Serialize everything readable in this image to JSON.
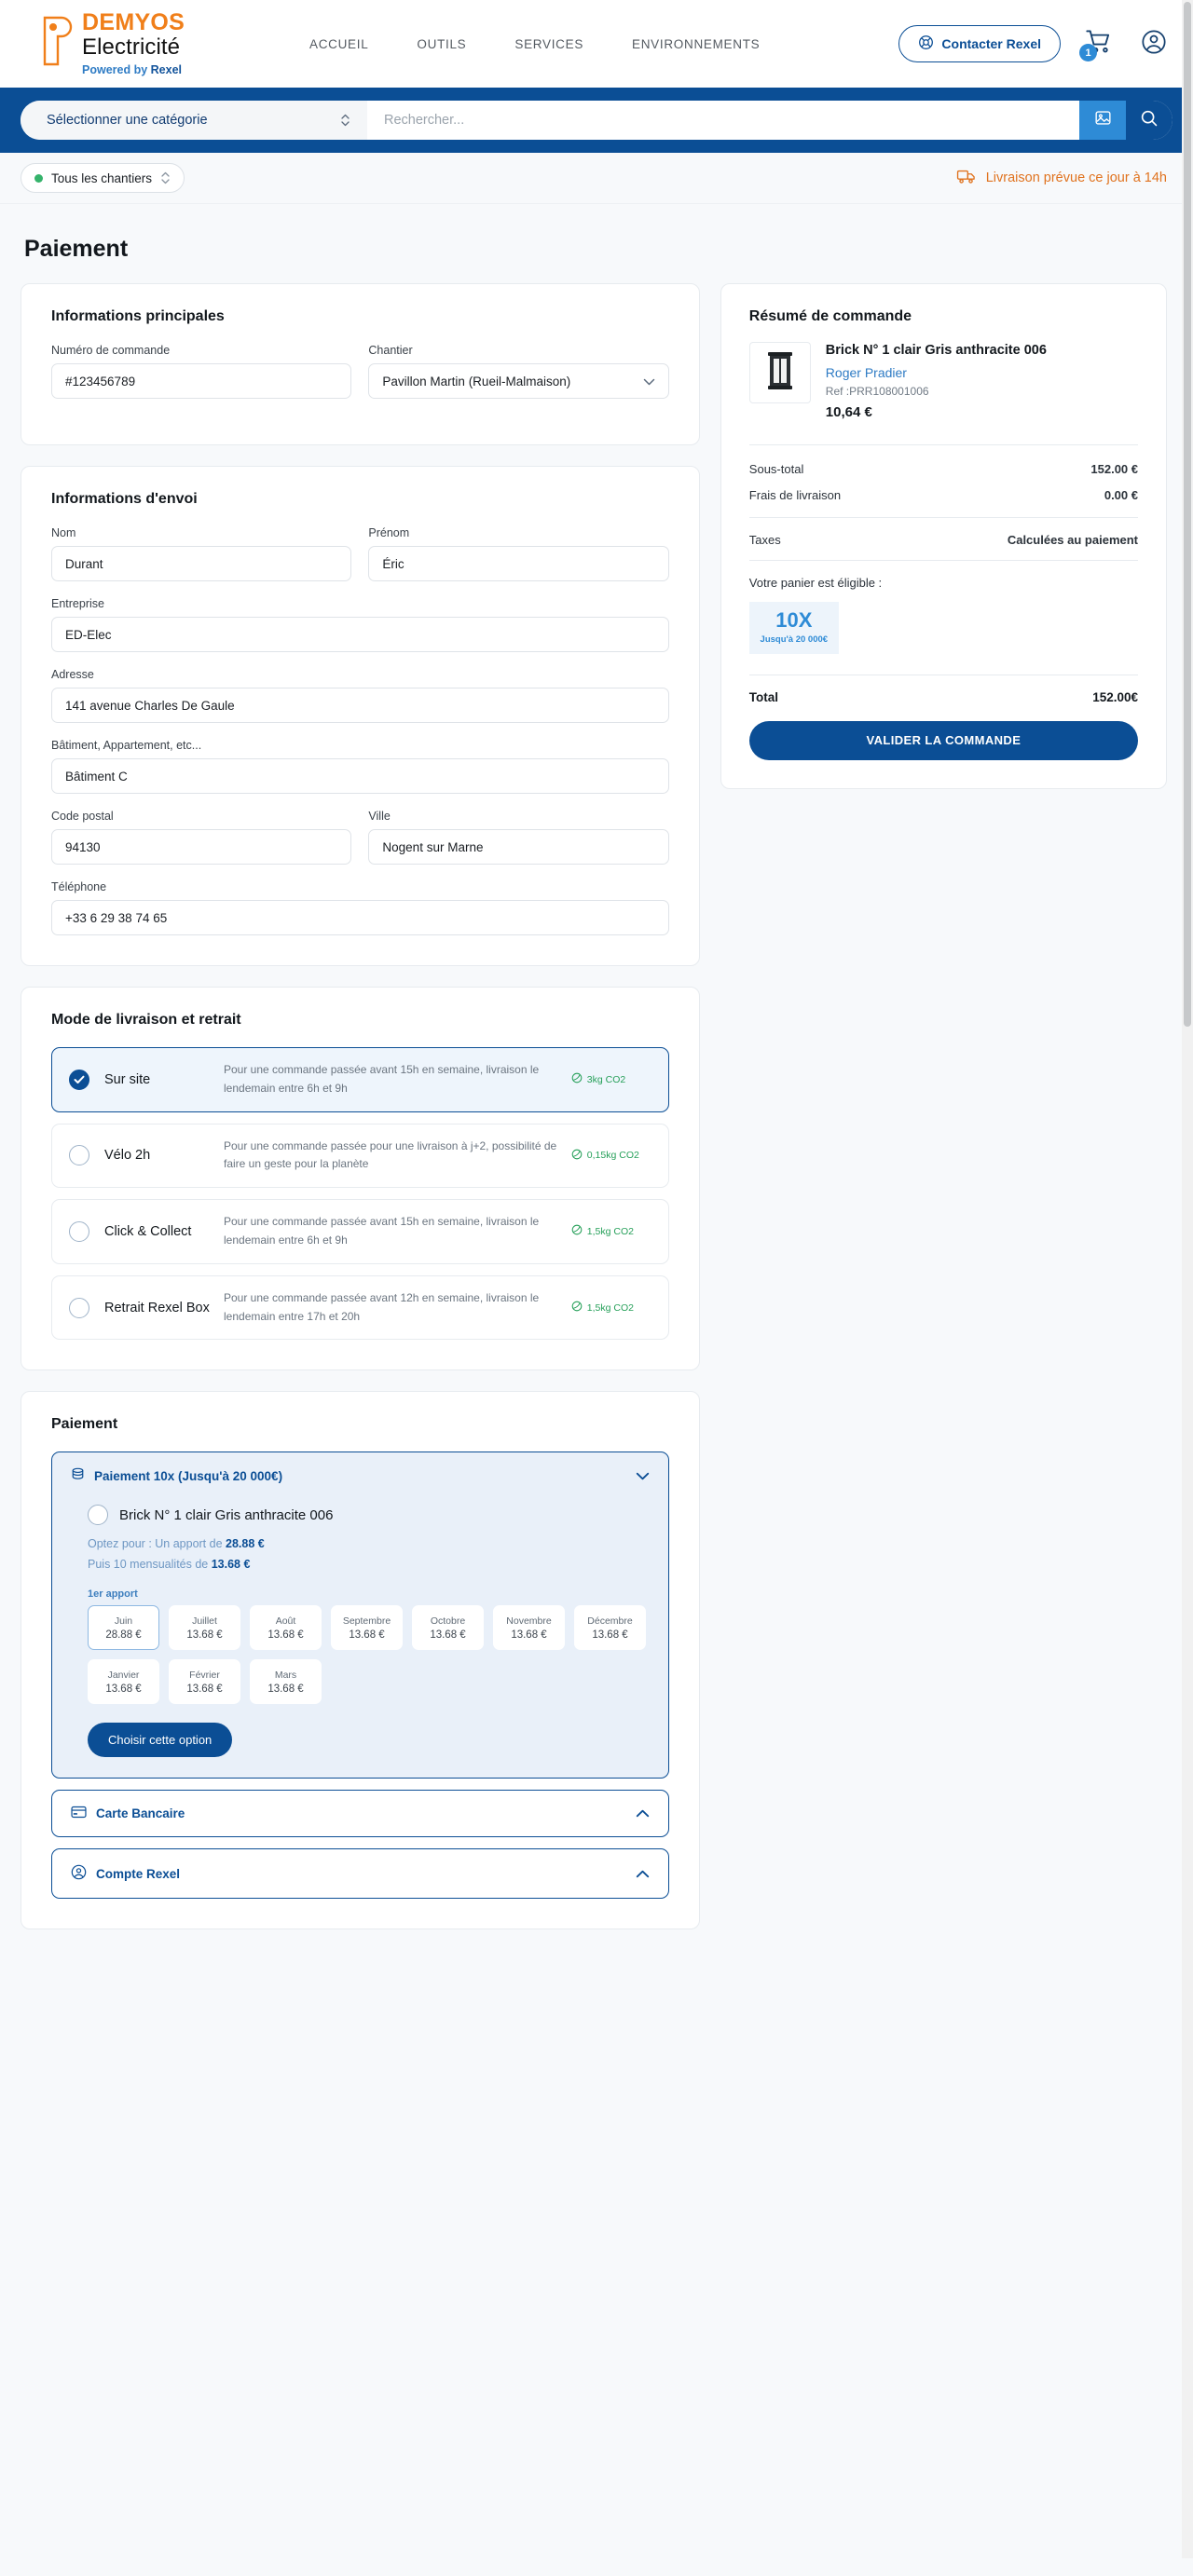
{
  "header": {
    "logo": {
      "name": "DEMYOS",
      "sub": "Electricité",
      "powered_prefix": "Powered by ",
      "powered_brand": "Rexel"
    },
    "menu": [
      "ACCUEIL",
      "OUTILS",
      "SERVICES",
      "ENVIRONNEMENTS"
    ],
    "contact_label": "Contacter Rexel",
    "cart_count": "1"
  },
  "search": {
    "category_placeholder": "Sélectionner une catégorie",
    "input_placeholder": "Rechercher...",
    "input_value": ""
  },
  "chantier_bar": {
    "selector_label": "Tous les chantiers",
    "delivery_note": "Livraison prévue ce jour à 14h"
  },
  "page": {
    "title": "Paiement"
  },
  "main_info": {
    "title": "Informations principales",
    "order_number_label": "Numéro de commande",
    "order_number_value": "#123456789",
    "chantier_label": "Chantier",
    "chantier_value": "Pavillon Martin (Rueil-Malmaison)"
  },
  "shipping": {
    "title": "Informations d'envoi",
    "fields": [
      {
        "label": "Nom",
        "value": "Durant"
      },
      {
        "label": "Prénom",
        "value": "Éric"
      },
      {
        "label": "Entreprise",
        "value": "ED-Elec"
      },
      {
        "label": "Adresse",
        "value": "141 avenue Charles De Gaule"
      },
      {
        "label": "Bâtiment, Appartement, etc...",
        "value": "Bâtiment C"
      },
      {
        "label": "Code postal",
        "value": "94130"
      },
      {
        "label": "Ville",
        "value": "Nogent sur Marne"
      },
      {
        "label": "Téléphone",
        "value": "+33 6 29 38 74 65"
      }
    ]
  },
  "delivery": {
    "title": "Mode de livraison et retrait",
    "options": [
      {
        "name": "Sur site",
        "desc": "Pour une commande passée avant 15h en semaine, livraison le lendemain entre 6h et 9h",
        "co2": "3kg CO2",
        "selected": true
      },
      {
        "name": "Vélo 2h",
        "desc": "Pour une commande passée pour une livraison à j+2, possibilité de faire un geste pour la planète",
        "co2": "0,15kg CO2",
        "selected": false
      },
      {
        "name": "Click & Collect",
        "desc": "Pour une commande passée avant 15h en semaine, livraison le lendemain entre 6h et 9h",
        "co2": "1,5kg CO2",
        "selected": false
      },
      {
        "name": "Retrait Rexel Box",
        "desc": "Pour une commande passée avant 12h en semaine, livraison le lendemain entre 17h et 20h",
        "co2": "1,5kg CO2",
        "selected": false
      }
    ]
  },
  "payment": {
    "title": "Paiement",
    "panel": {
      "header": "Paiement 10x (Jusqu'à 20 000€)",
      "product": "Brick N° 1 clair Gris anthracite 006",
      "line1_prefix": "Optez pour : Un apport de ",
      "line1_amount": "28.88 €",
      "line2_prefix": "Puis 10 mensualités de ",
      "line2_amount": "13.68 €",
      "apport_label": "1er apport",
      "schedule": [
        {
          "month": "Juin",
          "amount": "28.88 €",
          "first": true
        },
        {
          "month": "Juillet",
          "amount": "13.68 €",
          "first": false
        },
        {
          "month": "Août",
          "amount": "13.68 €",
          "first": false
        },
        {
          "month": "Septembre",
          "amount": "13.68 €",
          "first": false
        },
        {
          "month": "Octobre",
          "amount": "13.68 €",
          "first": false
        },
        {
          "month": "Novembre",
          "amount": "13.68 €",
          "first": false
        },
        {
          "month": "Décembre",
          "amount": "13.68 €",
          "first": false
        },
        {
          "month": "Janvier",
          "amount": "13.68 €",
          "first": false
        },
        {
          "month": "Février",
          "amount": "13.68 €",
          "first": false
        },
        {
          "month": "Mars",
          "amount": "13.68 €",
          "first": false
        }
      ],
      "choose_label": "Choisir cette option"
    },
    "other_methods": [
      {
        "label": "Carte Bancaire",
        "icon": "credit-card-icon"
      },
      {
        "label": "Compte Rexel",
        "icon": "account-circle-icon"
      }
    ]
  },
  "summary": {
    "title": "Résumé de commande",
    "product": {
      "name": "Brick N° 1 clair Gris anthracite 006",
      "brand": "Roger Pradier",
      "ref": "Ref :PRR108001006",
      "price": "10,64 €"
    },
    "lines": [
      {
        "label": "Sous-total",
        "value": "152.00 €"
      },
      {
        "label": "Frais de livraison",
        "value": "0.00 €"
      }
    ],
    "taxes_label": "Taxes",
    "taxes_value": "Calculées au paiement",
    "eligible_label": "Votre panier est éligible :",
    "badge_big": "10X",
    "badge_small": "Jusqu'à 20 000€",
    "total_label": "Total",
    "total_value": "152.00€",
    "validate_label": "VALIDER LA COMMANDE"
  },
  "colors": {
    "brand_blue": "#0B4E95",
    "accent_blue": "#2E8BD6",
    "orange": "#F07F1A",
    "green": "#27A05A",
    "delivery_orange": "#E0731F"
  }
}
